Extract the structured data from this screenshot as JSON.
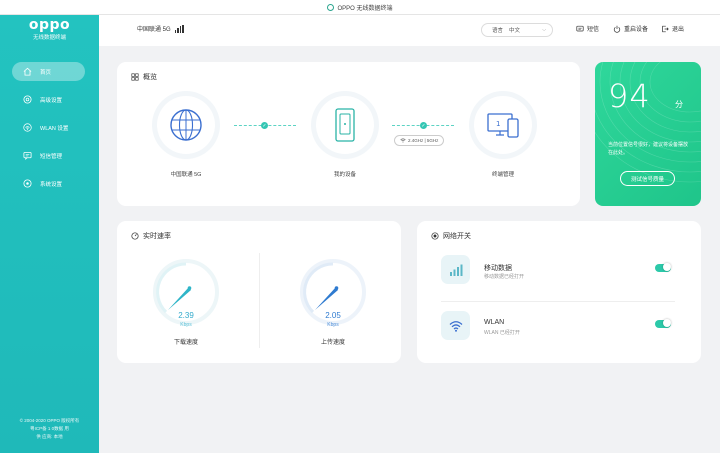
{
  "titlebar": {
    "title": "OPPO 无线数据终端"
  },
  "sidebar": {
    "brand": "oppo",
    "brand_sub": "无线数据终端",
    "items": [
      {
        "label": "首页",
        "icon": "home-icon",
        "active": true
      },
      {
        "label": "高级设置",
        "icon": "advanced-settings-icon",
        "active": false
      },
      {
        "label": "WLAN 设置",
        "icon": "wifi-icon",
        "active": false
      },
      {
        "label": "短信管理",
        "icon": "sms-icon",
        "active": false
      },
      {
        "label": "系统设置",
        "icon": "system-settings-icon",
        "active": false
      }
    ],
    "copyright": [
      "© 2004-2020 OPPO 版权所有",
      "粤ICP备 1 0数据 用",
      "供 应商: 本地"
    ]
  },
  "header": {
    "carrier": "中国联通 5G",
    "language_label": "语言",
    "language_value": "中文",
    "sms": "短信",
    "reboot": "重启设备",
    "logout": "退出"
  },
  "overview": {
    "title": "概览",
    "internet_label": "中国联通 5G",
    "device_label": "我的设备",
    "terminal_label": "终端管理",
    "band": "2.4GHz | 5GHz"
  },
  "score": {
    "value": "94",
    "unit": "分",
    "message": "当前位置信号很好，建议将设备摆放在此处。",
    "button": "测试信号质量"
  },
  "speed": {
    "title": "实时速率",
    "download_value": "2.39",
    "download_unit": "Kbps",
    "download_label": "下载速度",
    "upload_value": "2.05",
    "upload_unit": "Kbps",
    "upload_label": "上传速度"
  },
  "network": {
    "title": "网络开关",
    "mobile_name": "移动数据",
    "mobile_sub": "移动数据已经打开",
    "wlan_name": "WLAN",
    "wlan_sub": "WLAN 已经打开"
  },
  "colors": {
    "accent": "#23c3c0",
    "score_bg": "#2fd79b",
    "gauge": "#33aacc"
  }
}
